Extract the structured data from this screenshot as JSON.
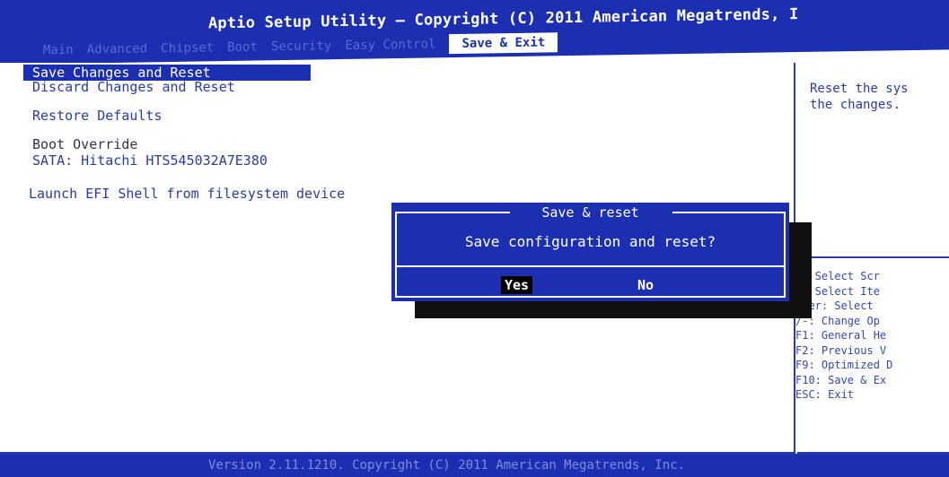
{
  "title": "Aptio Setup Utility – Copyright (C) 2011 American Megatrends, I",
  "tabs": [
    {
      "label": "Main"
    },
    {
      "label": "Advanced"
    },
    {
      "label": "Chipset"
    },
    {
      "label": "Boot"
    },
    {
      "label": "Security"
    },
    {
      "label": "Easy Control"
    },
    {
      "label": "Save & Exit"
    }
  ],
  "menu": {
    "save_changes_and_reset": "Save Changes and Reset",
    "discard_changes_and_reset": "Discard Changes and Reset",
    "restore_defaults": "Restore Defaults",
    "boot_override": "Boot Override",
    "sata_device": "SATA: Hitachi HTS545032A7E380",
    "launch_efi_shell": "Launch EFI Shell from filesystem device"
  },
  "help": {
    "description": "Reset the sys\nthe changes."
  },
  "keys": [
    "←: Select Scr",
    "↓: Select Ite",
    "nter: Select",
    "/-: Change Op",
    "F1: General He",
    "F2: Previous V",
    "F9: Optimized D",
    "F10: Save & Ex",
    "ESC: Exit"
  ],
  "dialog": {
    "title": "Save & reset",
    "message": "Save configuration and reset?",
    "yes_label": "Yes",
    "no_label": "No"
  },
  "footer": "Version 2.11.1210. Copyright (C) 2011 American Megatrends, Inc.",
  "colors": {
    "bios_blue": "#1c2fb0",
    "text_blue": "#2a3ab0",
    "white": "#ffffff",
    "selection_black": "#000000"
  }
}
